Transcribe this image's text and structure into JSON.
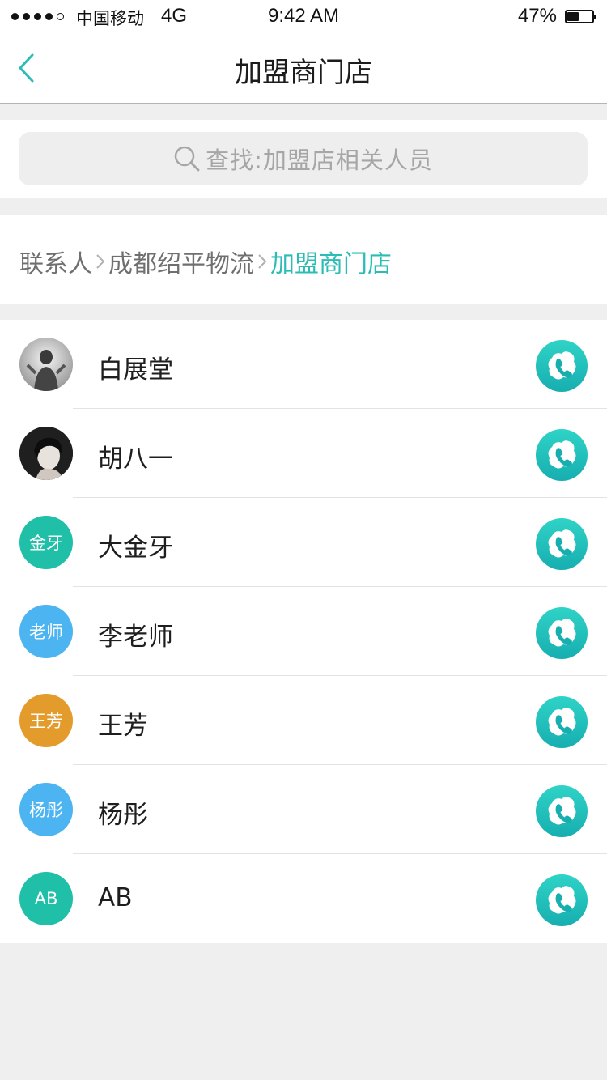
{
  "status_bar": {
    "carrier": "中国移动",
    "network": "4G",
    "time": "9:42 AM",
    "battery": "47%",
    "battery_level": 0.47,
    "signal_bars": 4,
    "signal_total": 5
  },
  "nav": {
    "title": "加盟商门店",
    "back_icon": "chevron-left-icon"
  },
  "search": {
    "placeholder": "查找:加盟店相关人员",
    "icon": "search-icon"
  },
  "breadcrumb": {
    "items": [
      "联系人",
      "成都绍平物流",
      "加盟商门店"
    ]
  },
  "colors": {
    "accent": "#2bbdb5",
    "call_gradient_top": "#2fd3c7",
    "call_gradient_bottom": "#17aeb0"
  },
  "contacts": [
    {
      "name": "白展堂",
      "avatar_type": "photo",
      "avatar_text": "",
      "avatar_color": "#cfcfcf"
    },
    {
      "name": "胡八一",
      "avatar_type": "photo",
      "avatar_text": "",
      "avatar_color": "#2b2b2b"
    },
    {
      "name": "大金牙",
      "avatar_type": "initials",
      "avatar_text": "金牙",
      "avatar_color": "#1fbfa8"
    },
    {
      "name": "李老师",
      "avatar_type": "initials",
      "avatar_text": "老师",
      "avatar_color": "#4bb4f1"
    },
    {
      "name": "王芳",
      "avatar_type": "initials",
      "avatar_text": "王芳",
      "avatar_color": "#e39c2c"
    },
    {
      "name": "杨彤",
      "avatar_type": "initials",
      "avatar_text": "杨彤",
      "avatar_color": "#4bb4f1"
    },
    {
      "name": "AB",
      "avatar_type": "initials",
      "avatar_text": "AB",
      "avatar_color": "#1fbfa8"
    }
  ]
}
